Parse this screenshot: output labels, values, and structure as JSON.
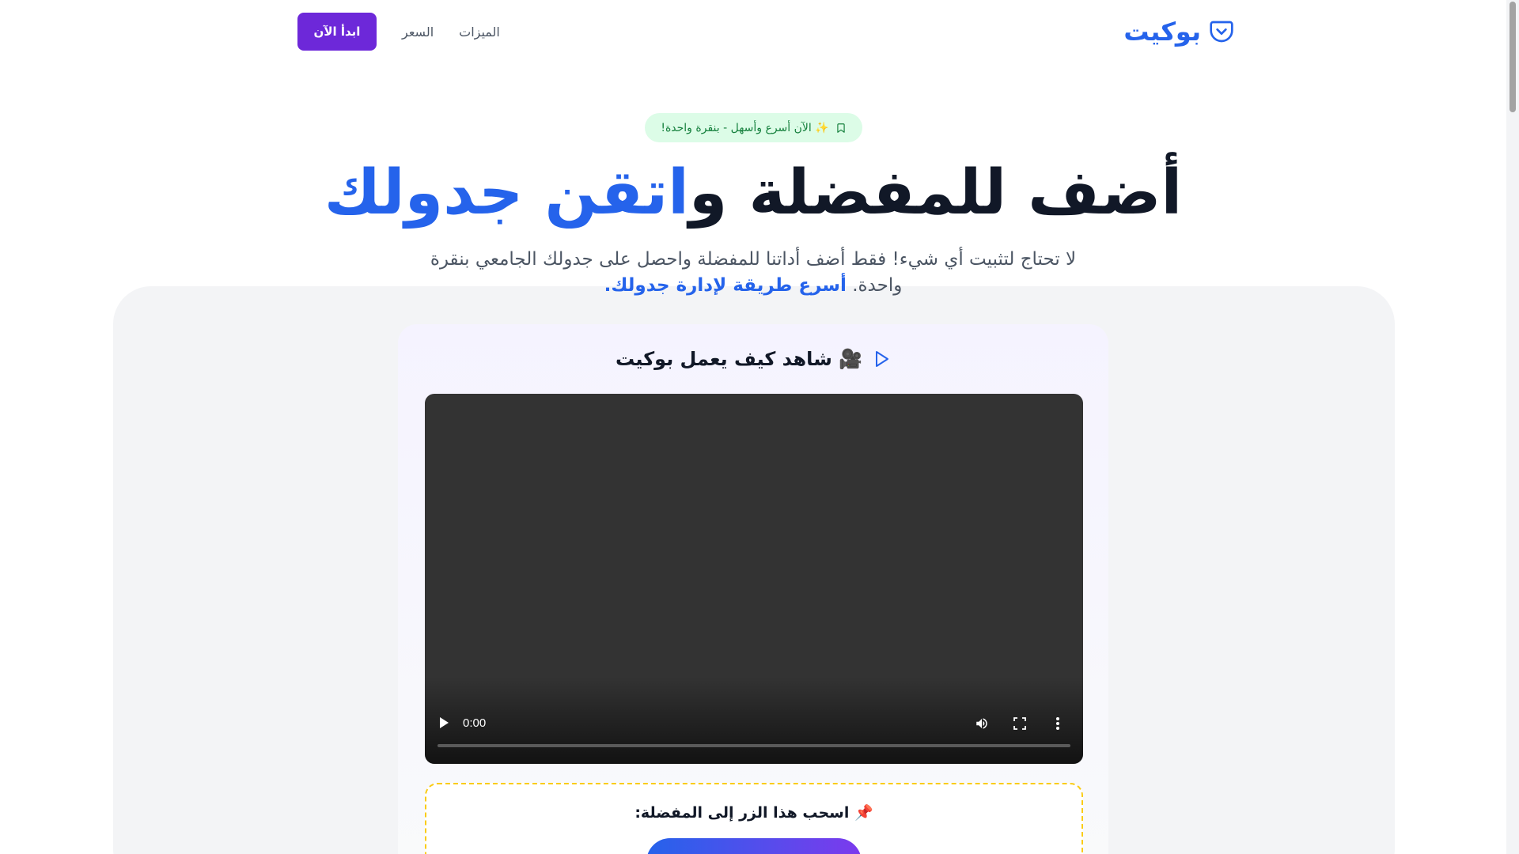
{
  "header": {
    "logo_text": "بوكيت",
    "nav": {
      "features": "الميزات",
      "pricing": "السعر"
    },
    "cta_label": "ابدأ الآن"
  },
  "hero": {
    "badge_text": "✨ الآن أسرع وأسهل - بنقرة واحدة!",
    "title_main": "أضف للمفضلة و",
    "title_accent": "اتقن جدولك",
    "subtitle_main": "لا تحتاج لتثبيت أي شيء! فقط أضف أداتنا للمفضلة واحصل على جدولك الجامعي بنقرة واحدة.",
    "subtitle_highlight": "أسرع طريقة لإدارة جدولك."
  },
  "demo": {
    "heading": "🎥 شاهد كيف يعمل بوكيت",
    "video": {
      "time": "0:00",
      "progress": 0
    },
    "drag_label": "📌 اسحب هذا الزر إلى المفضلة:"
  },
  "colors": {
    "brand": "#2563eb",
    "cta": "#6d28d9",
    "badge_bg": "#dcfce7",
    "badge_text": "#15803d",
    "dashed_border": "#facc15"
  },
  "icons": {
    "logo": "pocket-icon",
    "badge": "bookmark-icon",
    "demo_heading": "play-icon",
    "video_play": "play-icon",
    "video_volume": "volume-icon",
    "video_fullscreen": "fullscreen-icon",
    "video_more": "more-vertical-icon"
  }
}
